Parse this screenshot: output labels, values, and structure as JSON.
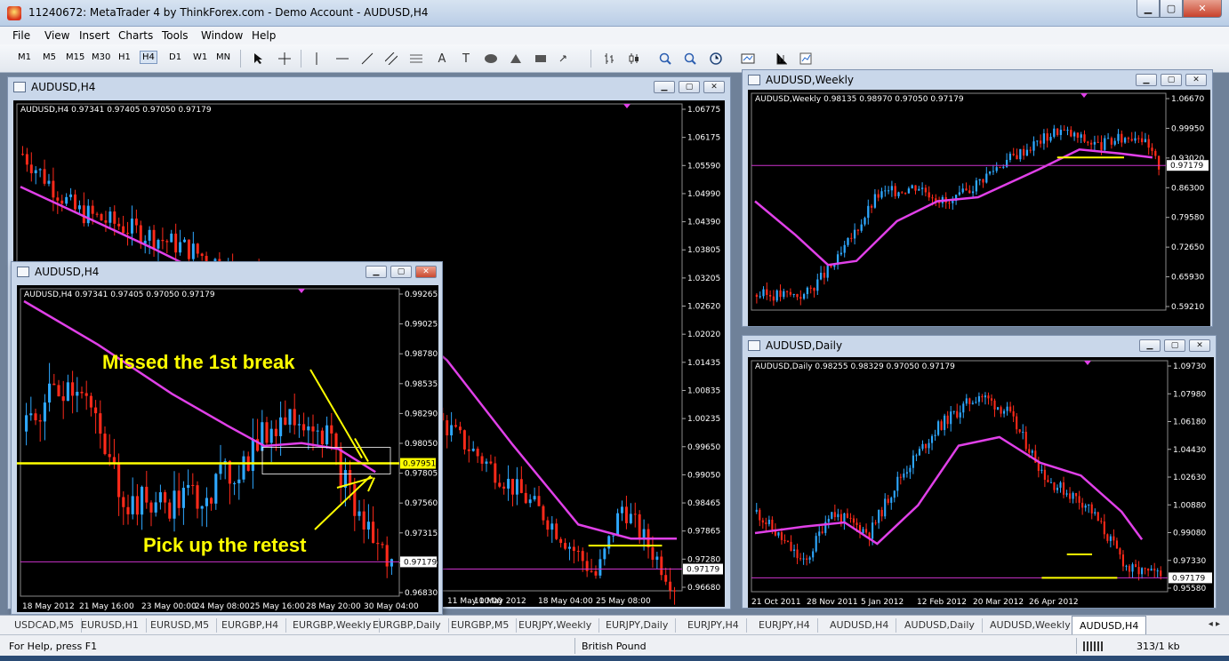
{
  "app": {
    "title": "11240672: MetaTrader 4 by ThinkForex.com - Demo Account - AUDUSD,H4",
    "controls": {
      "minimize": "▁",
      "maximize": "▢",
      "close": "✕"
    }
  },
  "menu": [
    "File",
    "View",
    "Insert",
    "Charts",
    "Tools",
    "Window",
    "Help"
  ],
  "toolbar": {
    "timeframes": [
      "M1",
      "M5",
      "M15",
      "M30",
      "H1",
      "H4",
      "D1",
      "W1",
      "MN"
    ],
    "selected_timeframe": "H4",
    "icons": [
      "cursor-icon",
      "crosshair-icon",
      "vertical-line-icon",
      "horizontal-line-icon",
      "trendline-icon",
      "equidistant-channel-icon",
      "fibonacci-icon",
      "text-icon",
      "text-label-icon",
      "ellipse-icon",
      "triangle-icon",
      "rectangle-icon",
      "arrows-icon",
      "bar-chart-icon",
      "candlestick-icon",
      "line-chart-icon",
      "zoom-in-icon",
      "zoom-out-icon",
      "periods-icon",
      "templates-icon",
      "indicators-icon",
      "chart-properties-icon"
    ],
    "glyphs": {
      "text": "A",
      "text_label": "T"
    }
  },
  "windows": {
    "h4_main": {
      "title": "AUDUSD,H4",
      "info": "AUDUSD,H4  0.97341 0.97405 0.97050 0.97179",
      "prices": [
        "1.06775",
        "1.06175",
        "1.05590",
        "1.04990",
        "1.04390",
        "1.03805",
        "1.03205",
        "1.02620",
        "1.02020",
        "1.01435",
        "1.00835",
        "1.00235",
        "0.99650",
        "0.99050",
        "0.98465",
        "0.97865",
        "0.97280",
        "0.96680"
      ],
      "current_price": "0.97179",
      "dates": [
        "11 May 00:00",
        "11 May 2012",
        "18 May 04:00",
        "25 May 08:00"
      ]
    },
    "h4_zoom": {
      "title": "AUDUSD,H4",
      "info": "AUDUSD,H4  0.97341 0.97405 0.97050 0.97179",
      "prices": [
        "0.99265",
        "0.99025",
        "0.98780",
        "0.98535",
        "0.98290",
        "0.98050",
        "0.97805",
        "0.97560",
        "0.97315",
        "0.97070",
        "0.96830"
      ],
      "current_price": "0.97179",
      "level_price": "0.97951",
      "dates": [
        "18 May 2012",
        "21 May 16:00",
        "23 May 00:00",
        "24 May 08:00",
        "25 May 16:00",
        "28 May 20:00",
        "30 May 04:00"
      ],
      "annotation_top": "Missed the 1st break",
      "annotation_bottom": "Pick up the retest"
    },
    "weekly": {
      "title": "AUDUSD,Weekly",
      "info": "AUDUSD,Weekly  0.98135 0.98970 0.97050 0.97179",
      "prices": [
        "1.06670",
        "0.99950",
        "0.93020",
        "0.86300",
        "0.79580",
        "0.72650",
        "0.65930",
        "0.59210"
      ],
      "current_price": "0.97179"
    },
    "daily": {
      "title": "AUDUSD,Daily",
      "info": "AUDUSD,Daily  0.98255 0.98329 0.97050 0.97179",
      "prices": [
        "1.09730",
        "1.07980",
        "1.06180",
        "1.04430",
        "1.02630",
        "1.00880",
        "0.99080",
        "0.97330",
        "0.95580"
      ],
      "current_price": "0.97179",
      "dates": [
        "21 Oct 2011",
        "28 Nov 2011",
        "5 Jan 2012",
        "12 Feb 2012",
        "20 Mar 2012",
        "26 Apr 2012"
      ]
    }
  },
  "tabs": [
    "USDCAD,M5",
    "EURUSD,H1",
    "EURUSD,M5",
    "EURGBP,H4",
    "EURGBP,Weekly",
    "EURGBP,Daily",
    "EURGBP,M5",
    "EURJPY,Weekly",
    "EURJPY,Daily",
    "EURJPY,H4",
    "EURJPY,H4",
    "AUDUSD,H4",
    "AUDUSD,Daily",
    "AUDUSD,Weekly",
    "AUDUSD,H4"
  ],
  "active_tab_index": 14,
  "status": {
    "help": "For Help, press F1",
    "profile": "British Pound",
    "traffic": "313/1 kb"
  },
  "colors": {
    "ma": "#e040e8",
    "bull": "#33aaff",
    "bear": "#ff2a1a",
    "level": "#ffff00",
    "current": "#cc33cc"
  }
}
